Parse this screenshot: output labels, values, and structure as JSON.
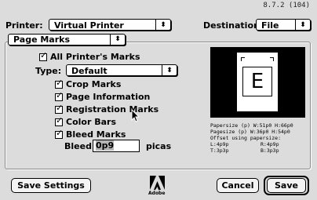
{
  "version": "8.7.2 (104)",
  "printer": {
    "label": "Printer:",
    "value": "Virtual Printer"
  },
  "destination": {
    "label": "Destination:",
    "value": "File"
  },
  "panel": {
    "selected": "Page Marks"
  },
  "marks": {
    "all_printers_marks": {
      "label": "All Printer's Marks",
      "checked": true
    },
    "type": {
      "label": "Type:",
      "value": "Default"
    },
    "crop_marks": {
      "label": "Crop Marks",
      "checked": true
    },
    "page_information": {
      "label": "Page Information",
      "checked": true
    },
    "registration_marks": {
      "label": "Registration Marks",
      "checked": true
    },
    "color_bars": {
      "label": "Color Bars",
      "checked": true
    },
    "bleed_marks": {
      "label": "Bleed Marks",
      "checked": true
    },
    "bleed": {
      "label": "Bleed:",
      "value": "0p9",
      "unit": "picas"
    }
  },
  "preview": {
    "page_letter": "E",
    "info_line1": "Papersize (p) W:51p0 H:66p0",
    "info_line2": "Pagesize (p) W:36p0 H:54p0",
    "info_line3": "Offset using papersize:",
    "offset_left": "L:4p9p",
    "offset_right": "R:4p9p",
    "offset_top": "T:3p3p",
    "offset_bottom": "B:3p3p"
  },
  "buttons": {
    "save_settings": "Save Settings",
    "cancel": "Cancel",
    "save": "Save"
  },
  "logo": {
    "text": "Adobe"
  },
  "icons": {
    "popup_arrow": "⬍",
    "checkmark": "✓"
  }
}
